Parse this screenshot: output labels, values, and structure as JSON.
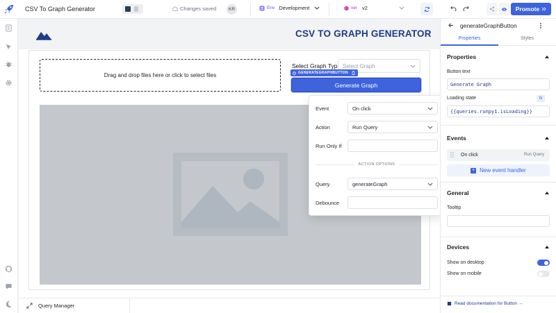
{
  "app": {
    "title": "CSV To Graph Generator",
    "status": "Changes saved",
    "avatar": "KR"
  },
  "env": {
    "tag": "Env",
    "value": "Development"
  },
  "version": {
    "tag": "ver",
    "value": "v2"
  },
  "toolbar": {
    "promote_label": "Promote"
  },
  "page": {
    "title": "CSV TO GRAPH GENERATOR",
    "dropzone_text": "Drag and drop files here or click to select files",
    "select_label": "Select Graph Type",
    "select_placeholder": "Select Graph",
    "component_tag": "GENERATEGRAPHBUTTON",
    "button_label": "Generate Graph"
  },
  "popover": {
    "event_label": "Event",
    "event_value": "On click",
    "action_label": "Action",
    "action_value": "Run Query",
    "run_only_if_label": "Run Only If",
    "run_only_if_value": "",
    "action_options_label": "ACTION OPTIONS",
    "query_label": "Query",
    "query_value": "generateGraph",
    "debounce_label": "Debounce",
    "debounce_value": ""
  },
  "inspector": {
    "component_name": "generateGraphButton",
    "tabs": [
      "Properties",
      "Styles"
    ],
    "properties_heading": "Properties",
    "button_text_label": "Button text",
    "button_text_value": "Generate Graph",
    "loading_state_label": "Loading state",
    "loading_state_value": "{{queries.runpy1.isLoading}}",
    "fx_label": "fx",
    "events_heading": "Events",
    "event_row": {
      "event": "On click",
      "action": "Run Query"
    },
    "new_event_label": "New event handler",
    "general_heading": "General",
    "tooltip_label": "Tooltip",
    "tooltip_value": "",
    "devices_heading": "Devices",
    "show_desktop_label": "Show on desktop",
    "show_desktop_on": true,
    "show_mobile_label": "Show on mobile",
    "show_mobile_on": false,
    "docs_link": "Read documentation for Button →"
  },
  "bottom": {
    "query_manager_label": "Query Manager"
  },
  "colors": {
    "accent": "#3e63dd",
    "title": "#1e3a8a",
    "image_placeholder": "#c4c7cb"
  }
}
